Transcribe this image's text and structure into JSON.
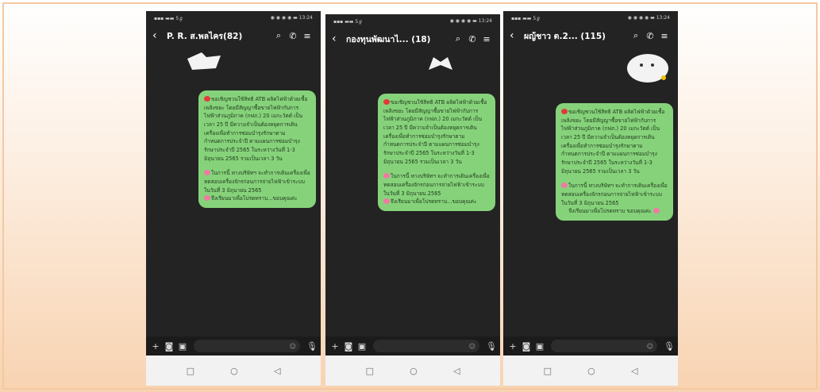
{
  "phones": [
    {
      "status": {
        "left": "▪▪▪ ▬▬ 5ℊ",
        "right": "◉ ◉ ◉ ◉ ▬ 13:24"
      },
      "title": "P. R. ส.พลไคร(82)",
      "bubble": {
        "p1": "ขอเชิญชวนใช้สิทธิ ATB ผลิตไฟฟ้าด้วยเชื้อเพลิงขยะ โดยมีสัญญาซื้อขายไฟฟ้ากับการไฟฟ้าส่วนภูมิภาค (กฟภ.) 20 เมกะวัตต์ เป็นเวลา 25 ปี มีความจำเป็นต้องหยุดการเดินเครื่องเพื่อทำการซ่อมบำรุงรักษาตามกำหนดการประจำปี ตามแผนการซ่อมบำรุงรักษาประจำปี 2565 ในระหว่างวันที่ 1-3 มิถุนายน 2565 รวมเป็นเวลา 3 วัน",
        "p2": "ในการนี้ ทางบริษัทฯ จะทำการเดินเครื่องเพื่อทดสอบเครื่องจักรก่อนการจ่ายไฟฟ้าเข้าระบบ ในวันที่ 3 มิถุนายน 2565",
        "p3": "จึงเรียนมาเพื่อโปรดทราบ...ขอบคุณค่ะ"
      }
    },
    {
      "status": {
        "left": "▪▪▪ ▬▬ 5ℊ",
        "right": "◉ ◉ ◉ ◉ ▬ 13:24"
      },
      "title": "กองทุนพัฒนาไ... (18)",
      "bubble": {
        "p1": "ขอเชิญชวนใช้สิทธิ ATB ผลิตไฟฟ้าด้วยเชื้อเพลิงขยะ โดยมีสัญญาซื้อขายไฟฟ้ากับการไฟฟ้าส่วนภูมิภาค (กฟภ.) 20 เมกะวัตต์ เป็นเวลา 25 ปี มีความจำเป็นต้องหยุดการเดินเครื่องเพื่อทำการซ่อมบำรุงรักษาตามกำหนดการประจำปี ตามแผนการซ่อมบำรุงรักษาประจำปี 2565 ในระหว่างวันที่ 1-3 มิถุนายน 2565 รวมเป็นเวลา 3 วัน",
        "p2": "ในการนี้ ทางบริษัทฯ จะทำการเดินเครื่องเพื่อทดสอบเครื่องจักรก่อนการจ่ายไฟฟ้าเข้าระบบ ในวันที่ 3 มิถุนายน 2565",
        "p3": "จึงเรียนมาเพื่อโปรดทราบ...ขอบคุณค่ะ"
      }
    },
    {
      "status": {
        "left": "▪▪▪ ▬▬ 5ℊ",
        "right": "◉ ◉ ◉ ◉ ▬ 13:24"
      },
      "title": "ผญ้ชาว ต.2...  (115)",
      "bubble": {
        "p1": "ขอเชิญชวนใช้สิทธิ ATB ผลิตไฟฟ้าด้วยเชื้อเพลิงขยะ โดยมีสัญญาซื้อขายไฟฟ้ากับการไฟฟ้าส่วนภูมิภาค (กฟภ.) 20 เมกะวัตต์ เป็นเวลา 25 ปี มีความจำเป็นต้องหยุดการเดินเครื่องเพื่อทำการซ่อมบำรุงรักษาตามกำหนดการประจำปี ตามแผนการซ่อมบำรุงรักษาประจำปี 2565 ในระหว่างวันที่ 1-3 มิถุนายน 2565 รวมเป็นเวลา 3 วัน",
        "p2": "ในการนี้ ทางบริษัทฯ จะทำการเดินเครื่องเพื่อทดสอบเครื่องจักรก่อนการจ่ายไฟฟ้าเข้าระบบ ในวันที่ 3 มิถุนายน 2565",
        "p3": "จึงเรียนมาเพื่อโปรดทราบ ขอบคุณค่ะ"
      }
    }
  ],
  "icons": {
    "back": "back-arrow-icon",
    "search": "search-icon",
    "call": "phone-icon",
    "menu": "menu-icon",
    "plus": "plus-icon",
    "camera": "camera-icon",
    "image": "image-icon",
    "emoji": "emoji-icon",
    "mic": "microphone-icon",
    "nav_recent": "recent-apps-icon",
    "nav_home": "home-icon",
    "nav_back": "nav-back-icon"
  },
  "colors": {
    "chat_bg": "#232323",
    "bubble": "#86d27b",
    "accent_border": "#f4c8a0"
  }
}
